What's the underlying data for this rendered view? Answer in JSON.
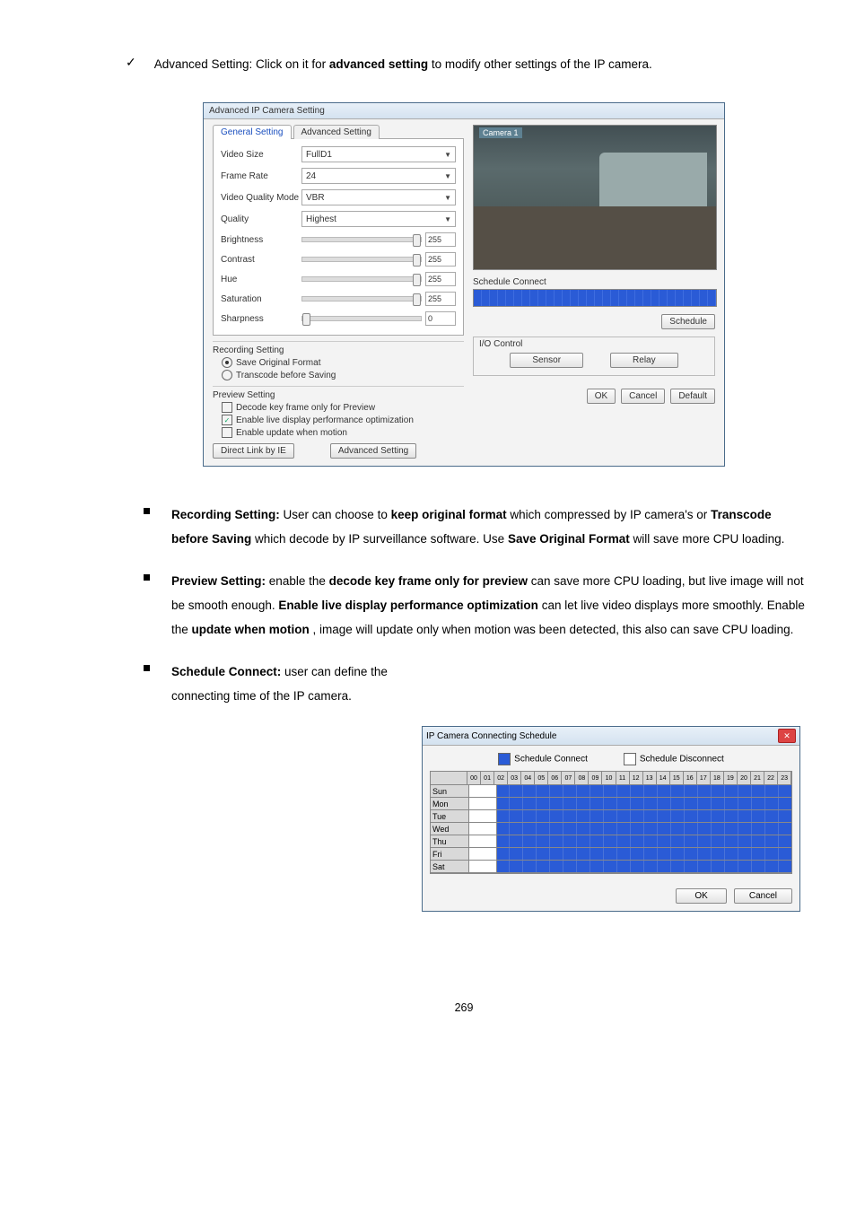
{
  "intro": {
    "lead_in": "Advanced Setting: Click on it for",
    "bold1": "advanced setting",
    "after": "to modify other settings of the IP camera."
  },
  "dialog1": {
    "title": "Advanced IP Camera Setting",
    "tab_general": "General Setting",
    "tab_advanced": "Advanced Setting",
    "video_size_lbl": "Video Size",
    "video_size_val": "FullD1",
    "frame_rate_lbl": "Frame Rate",
    "frame_rate_val": "24",
    "vqm_lbl": "Video Quality Mode",
    "vqm_val": "VBR",
    "quality_lbl": "Quality",
    "quality_val": "Highest",
    "brightness_lbl": "Brightness",
    "brightness_val": "255",
    "contrast_lbl": "Contrast",
    "contrast_val": "255",
    "hue_lbl": "Hue",
    "hue_val": "255",
    "saturation_lbl": "Saturation",
    "saturation_val": "255",
    "sharpness_lbl": "Sharpness",
    "sharpness_val": "0",
    "rec_hdr": "Recording Setting",
    "rec_opt1": "Save Original Format",
    "rec_opt2": "Transcode before Saving",
    "prev_hdr": "Preview Setting",
    "prev_c1": "Decode key frame only for Preview",
    "prev_c2": "Enable live display performance optimization",
    "prev_c3": "Enable update when motion",
    "direct_link": "Direct Link by IE",
    "adv_set_btn": "Advanced Setting",
    "preview_cam": "Camera 1",
    "schedule_connect_lbl": "Schedule Connect",
    "schedule_btn": "Schedule",
    "io_hdr": "I/O Control",
    "sensor_btn": "Sensor",
    "relay_btn": "Relay",
    "ok": "OK",
    "cancel": "Cancel",
    "default": "Default"
  },
  "para1": {
    "title": "Recording Setting:",
    "line1a": "User can choose to ",
    "bold1": "keep original format",
    "line1b": " which compressed by IP camera's or ",
    "bold2": "Transcode before Saving",
    "line1c": " which decode by IP surveillance software. Use ",
    "bold3": "Save Original Format",
    "line1d": " will save more CPU loading."
  },
  "para2": {
    "title": "Preview Setting:",
    "lead": " enable the ",
    "bold1": "decode key frame only for preview",
    "mid1": " can save more CPU loading, but live image will not be smooth enough. ",
    "bold2": "Enable live display performance optimization",
    "mid2": " can let live video displays more smoothly. Enable the ",
    "bold3": "update when motion",
    "mid3": ", image will update only when motion was been detected, this also can save CPU loading."
  },
  "para3": {
    "title": "Schedule Connect:",
    "text": " user can define the connecting time of the IP camera."
  },
  "dialog2": {
    "title": "IP Camera Connecting Schedule",
    "legend_connect": "Schedule Connect",
    "legend_disconnect": "Schedule Disconnect",
    "hours": [
      "00",
      "01",
      "02",
      "03",
      "04",
      "05",
      "06",
      "07",
      "08",
      "09",
      "10",
      "11",
      "12",
      "13",
      "14",
      "15",
      "16",
      "17",
      "18",
      "19",
      "20",
      "21",
      "22",
      "23"
    ],
    "days": [
      "Sun",
      "Mon",
      "Tue",
      "Wed",
      "Thu",
      "Fri",
      "Sat"
    ],
    "ok": "OK",
    "cancel": "Cancel"
  },
  "page": "269"
}
